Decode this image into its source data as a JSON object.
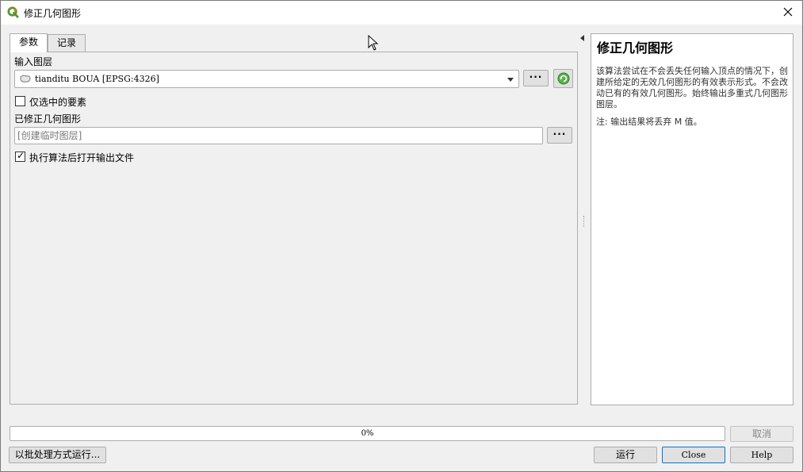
{
  "window": {
    "title": "修正几何图形",
    "icon": "qgis-logo-icon",
    "close_icon": "close-icon"
  },
  "tabs": [
    {
      "label": "参数",
      "active": true
    },
    {
      "label": "记录",
      "active": false
    }
  ],
  "params": {
    "input_layer_label": "输入图层",
    "input_layer_value": "tianditu BOUA [EPSG:4326]",
    "selected_only_label": "仅选中的要素",
    "selected_only_checked": false,
    "output_label": "已修正几何图形",
    "output_placeholder": "[创建临时图层]",
    "open_output_label": "执行算法后打开输出文件",
    "open_output_checked": true,
    "browse_label": "···"
  },
  "help": {
    "title": "修正几何图形",
    "description": "该算法尝试在不会丢失任何输入顶点的情况下，创建所给定的无效几何图形的有效表示形式。不会改动已有的有效几何图形。始终输出多重式几何图形图层。",
    "note": "注: 输出结果将丢弃 M 值。"
  },
  "progress": {
    "text": "0%",
    "value": 0
  },
  "buttons": {
    "cancel": "取消",
    "batch": "以批处理方式运行...",
    "run": "运行",
    "close": "Close",
    "help": "Help"
  },
  "colors": {
    "accent": "#0078d7",
    "qgis_green": "#589632",
    "refresh_green": "#3a9b35"
  }
}
